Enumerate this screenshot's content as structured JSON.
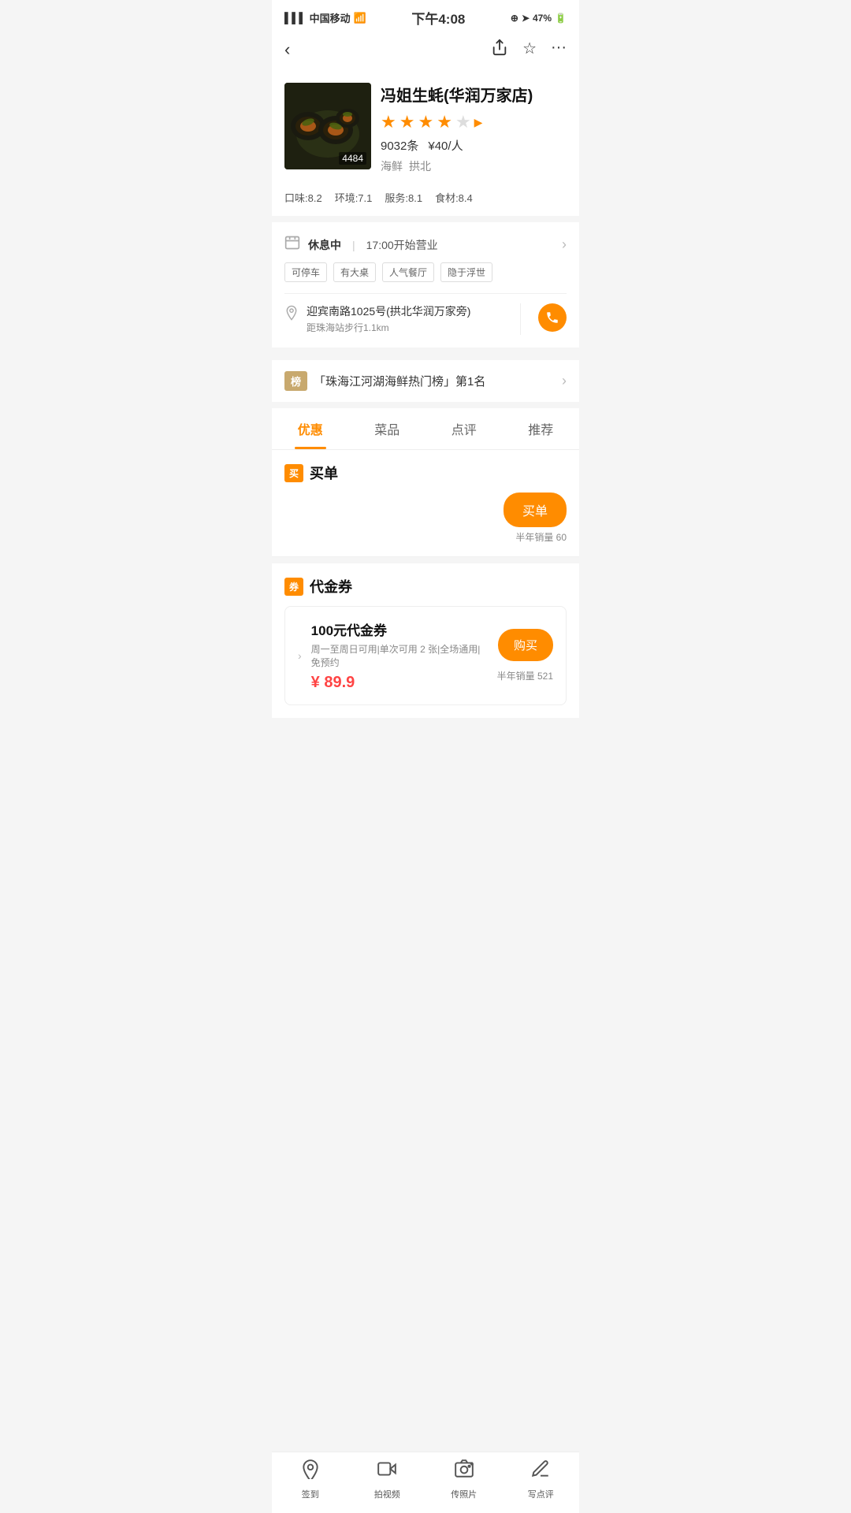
{
  "statusBar": {
    "carrier": "中国移动",
    "time": "下午4:08",
    "battery": "47%"
  },
  "nav": {
    "backLabel": "‹",
    "shareIcon": "share",
    "starIcon": "star",
    "moreIcon": "more"
  },
  "restaurant": {
    "name": "冯姐生蚝(华润万家店)",
    "imgCount": "4484",
    "starCount": 4,
    "reviewCount": "9032条",
    "pricePerPerson": "¥40/人",
    "categories": [
      "海鲜",
      "拱北"
    ],
    "ratings": {
      "taste": "口味:8.2",
      "env": "环境:7.1",
      "service": "服务:8.1",
      "ingredients": "食材:8.4"
    }
  },
  "businessInfo": {
    "status": "休息中",
    "divider": "|",
    "openTime": "17:00开始营业",
    "tags": [
      "可停车",
      "有大桌",
      "人气餐厅",
      "隐于浮世"
    ],
    "address": "迎宾南路1025号(拱北华润万家旁)",
    "distance": "距珠海站步行1.1km"
  },
  "ranking": {
    "badge": "榜",
    "text": "「珠海江河湖海鲜热门榜」第1名"
  },
  "tabs": [
    {
      "label": "优惠",
      "active": true
    },
    {
      "label": "菜品",
      "active": false
    },
    {
      "label": "点评",
      "active": false
    },
    {
      "label": "推荐",
      "active": false
    }
  ],
  "buySection": {
    "icon": "买",
    "title": "买单",
    "buyBtnLabel": "买单",
    "salesText": "半年销量 60"
  },
  "voucherSection": {
    "icon": "券",
    "title": "代金券",
    "voucher": {
      "name": "100元代金券",
      "desc": "周一至周日可用|单次可用 2 张|全场通用|免预约",
      "price": "¥ 89.9",
      "purchaseBtnLabel": "购买",
      "salesText": "半年销量 521"
    }
  },
  "bottomNav": [
    {
      "icon": "📍",
      "label": "签到"
    },
    {
      "icon": "🎬",
      "label": "拍视频"
    },
    {
      "icon": "📷",
      "label": "传照片"
    },
    {
      "icon": "✍️",
      "label": "写点评"
    }
  ]
}
